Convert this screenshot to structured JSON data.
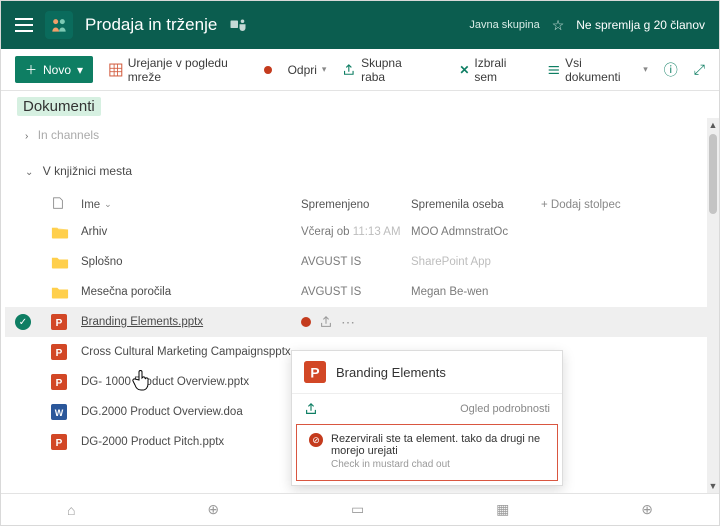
{
  "header": {
    "title": "Prodaja in trženje",
    "group_type": "Javna skupina",
    "follow": "Ne spremlja g 20 članov"
  },
  "cmdbar": {
    "new": "Novo",
    "edit_grid": "Urejanje v pogledu mreže",
    "open": "Odpri",
    "share": "Skupna raba",
    "selected": "Izbrali sem",
    "all_docs": "Vsi dokumenti"
  },
  "breadcrumb": "Dokumenti",
  "sections": {
    "channels": "In channels",
    "library": "V knjižnici mesta"
  },
  "columns": {
    "name": "Ime",
    "modified": "Spremenjeno",
    "modified_by": "Spremenila oseba",
    "add_col": "Dodaj stolpec"
  },
  "rows": [
    {
      "type": "folder",
      "name": "Arhiv",
      "modified": "Včeraj ob",
      "modified_time": "11:13 AM",
      "by": "MOO AdmnstratOc"
    },
    {
      "type": "folder",
      "name": "Splošno",
      "modified": "AVGUST IS",
      "by": "SharePoint App"
    },
    {
      "type": "folder",
      "name": "Mesečna poročila",
      "modified": "AVGUST IS",
      "by": "Megan Be-wen"
    },
    {
      "type": "ppt",
      "name": "Branding Elements.pptx",
      "selected": true,
      "underline": true
    },
    {
      "type": "ppt",
      "name": "Cross Cultural Marketing Campaignspptx"
    },
    {
      "type": "ppt",
      "name": "DG- 1000 Product Overview.pptx"
    },
    {
      "type": "word",
      "name": "DG.2000 Product Overview.doa"
    },
    {
      "type": "ppt",
      "name": "DG-2000 Product Pitch.pptx"
    }
  ],
  "card": {
    "title": "Branding Elements",
    "details": "Ogled podrobnosti",
    "msg1": "Rezervirali ste ta element. tako da drugi ne morejo urejati",
    "msg2": "Check in mustard chad out"
  }
}
